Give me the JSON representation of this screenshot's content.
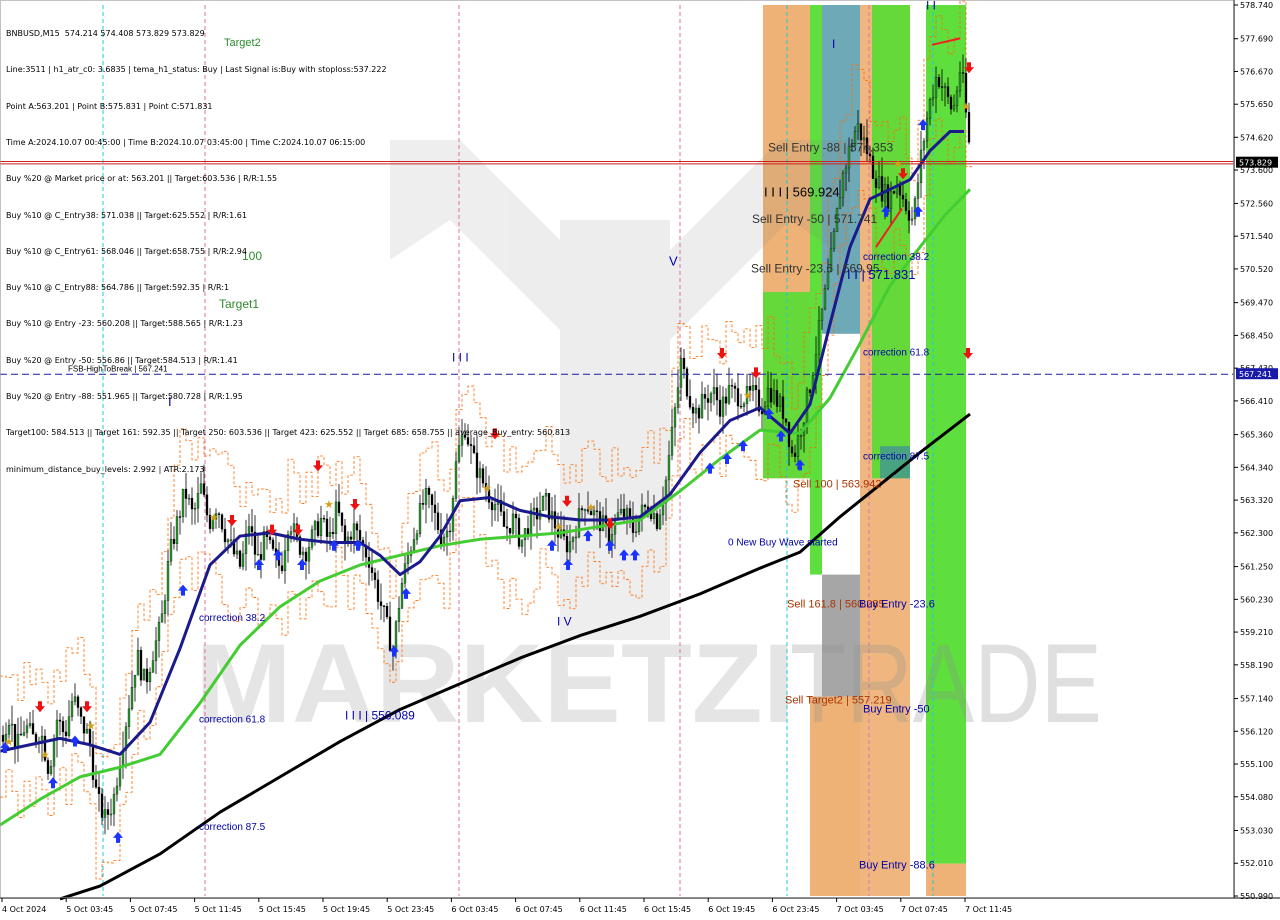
{
  "header_lines": [
    "BNBUSD,M15  574.214 574.408 573.829 573.829",
    "Line:3511 | h1_atr_c0: 3.6835 | tema_h1_status: Buy | Last Signal is:Buy with stoploss:537.222",
    "Point A:563.201 | Point B:575.831 | Point C:571.831",
    "Time A:2024.10.07 00:45:00 | Time B:2024.10.07 03:45:00 | Time C:2024.10.07 06:15:00",
    "Buy %20 @ Market price or at: 563.201 || Target:603.536 | R/R:1.55",
    "Buy %10 @ C_Entry38: 571.038 || Target:625.552 | R/R:1.61",
    "Buy %10 @ C_Entry61: 568.046 || Target:658.755 | R/R:2.94",
    "Buy %10 @ C_Entry88: 564.786 || Target:592.35 | R/R:1",
    "Buy %10 @ Entry -23: 560.208 || Target:588.565 | R/R:1.23",
    "Buy %20 @ Entry -50: 556.86 || Target:584.513 | R/R:1.41",
    "Buy %20 @ Entry -88: 551.965 || Target:580.728 | R/R:1.95",
    "Target100: 584.513 || Target 161: 592.35 || Target 250: 603.536 || Target 423: 625.552 || Target 685: 658.755 || average_Buy_entry: 560.813",
    "minimum_distance_buy_levels: 2.992 | ATR:2.173"
  ],
  "chart_data": {
    "type": "candlestick",
    "symbol": "BNBUSD",
    "timeframe": "M15",
    "ylim": [
      550.99,
      578.74
    ],
    "y_ticks": [
      578.74,
      577.69,
      576.67,
      575.65,
      574.62,
      573.6,
      572.56,
      571.54,
      570.52,
      569.47,
      568.45,
      567.43,
      566.41,
      565.36,
      564.34,
      563.32,
      562.3,
      561.25,
      560.23,
      559.21,
      558.19,
      557.14,
      556.12,
      555.1,
      554.08,
      553.03,
      552.01,
      550.99
    ],
    "y_tick_labels": [
      "578.740",
      "577.690",
      "576.670",
      "575.650",
      "574.620",
      "573.600",
      "572.560",
      "571.540",
      "570.520",
      "569.470",
      "568.450",
      "567.430",
      "566.410",
      "565.360",
      "564.340",
      "563.320",
      "562.300",
      "561.250",
      "560.230",
      "559.210",
      "558.190",
      "557.140",
      "556.120",
      "555.100",
      "554.080",
      "553.030",
      "552.010",
      "550.990"
    ],
    "x_labels": [
      "4 Oct 2024",
      "5 Oct 03:45",
      "5 Oct 07:45",
      "5 Oct 11:45",
      "5 Oct 15:45",
      "5 Oct 19:45",
      "5 Oct 23:45",
      "6 Oct 03:45",
      "6 Oct 07:45",
      "6 Oct 11:45",
      "6 Oct 15:45",
      "6 Oct 19:45",
      "6 Oct 23:45",
      "7 Oct 03:45",
      "7 Oct 07:45",
      "7 Oct 11:45"
    ],
    "current_price": 573.829,
    "current_price_label": "573.829",
    "fsb_level": 567.241,
    "fsb_level_label": "567.241",
    "close_path": [
      [
        0,
        556.0
      ],
      [
        8,
        556.6
      ],
      [
        16,
        555.6
      ],
      [
        24,
        556.3
      ],
      [
        32,
        555.9
      ],
      [
        40,
        556.1
      ],
      [
        48,
        554.9
      ],
      [
        56,
        556.5
      ],
      [
        64,
        556.0
      ],
      [
        72,
        557.2
      ],
      [
        80,
        556.4
      ],
      [
        88,
        555.9
      ],
      [
        96,
        554.0
      ],
      [
        104,
        553.4
      ],
      [
        112,
        553.9
      ],
      [
        120,
        555.5
      ],
      [
        128,
        557.0
      ],
      [
        136,
        558.5
      ],
      [
        144,
        557.6
      ],
      [
        152,
        558.6
      ],
      [
        160,
        559.4
      ],
      [
        168,
        561.5
      ],
      [
        176,
        562.6
      ],
      [
        184,
        563.6
      ],
      [
        192,
        562.8
      ],
      [
        200,
        563.7
      ],
      [
        208,
        562.6
      ],
      [
        216,
        563.2
      ],
      [
        224,
        562.3
      ],
      [
        232,
        561.7
      ],
      [
        240,
        561.2
      ],
      [
        248,
        562.6
      ],
      [
        256,
        561.4
      ],
      [
        264,
        562.1
      ],
      [
        272,
        561.6
      ],
      [
        280,
        561.2
      ],
      [
        288,
        562.8
      ],
      [
        296,
        562.0
      ],
      [
        304,
        561.7
      ],
      [
        312,
        562.2
      ],
      [
        320,
        562.7
      ],
      [
        328,
        562.0
      ],
      [
        336,
        563.1
      ],
      [
        344,
        561.9
      ],
      [
        352,
        562.5
      ],
      [
        360,
        562.0
      ],
      [
        368,
        561.5
      ],
      [
        376,
        560.5
      ],
      [
        384,
        559.6
      ],
      [
        392,
        558.6
      ],
      [
        400,
        560.6
      ],
      [
        408,
        561.7
      ],
      [
        416,
        562.6
      ],
      [
        424,
        563.4
      ],
      [
        432,
        563.0
      ],
      [
        440,
        562.2
      ],
      [
        448,
        562.4
      ],
      [
        456,
        564.7
      ],
      [
        464,
        565.6
      ],
      [
        472,
        564.6
      ],
      [
        480,
        564.0
      ],
      [
        488,
        563.5
      ],
      [
        496,
        563.1
      ],
      [
        504,
        562.4
      ],
      [
        512,
        562.7
      ],
      [
        520,
        562.0
      ],
      [
        528,
        562.6
      ],
      [
        536,
        562.9
      ],
      [
        544,
        563.3
      ],
      [
        552,
        562.7
      ],
      [
        560,
        562.1
      ],
      [
        568,
        561.9
      ],
      [
        576,
        562.6
      ],
      [
        584,
        563.3
      ],
      [
        592,
        562.9
      ],
      [
        600,
        562.6
      ],
      [
        608,
        562.2
      ],
      [
        616,
        562.8
      ],
      [
        624,
        562.9
      ],
      [
        632,
        562.4
      ],
      [
        640,
        562.9
      ],
      [
        648,
        563.2
      ],
      [
        656,
        562.7
      ],
      [
        664,
        563.7
      ],
      [
        672,
        565.6
      ],
      [
        680,
        567.6
      ],
      [
        688,
        566.6
      ],
      [
        696,
        566.0
      ],
      [
        704,
        566.5
      ],
      [
        712,
        566.7
      ],
      [
        720,
        566.2
      ],
      [
        728,
        566.7
      ],
      [
        736,
        566.6
      ],
      [
        744,
        566.5
      ],
      [
        752,
        566.6
      ],
      [
        760,
        566.2
      ],
      [
        768,
        566.8
      ],
      [
        776,
        566.4
      ],
      [
        784,
        566.0
      ],
      [
        792,
        564.6
      ],
      [
        800,
        565.6
      ],
      [
        808,
        566.7
      ],
      [
        816,
        568.2
      ],
      [
        824,
        569.7
      ],
      [
        832,
        571.2
      ],
      [
        840,
        573.2
      ],
      [
        848,
        574.2
      ],
      [
        856,
        575.0
      ],
      [
        864,
        574.4
      ],
      [
        872,
        573.6
      ],
      [
        880,
        573.0
      ],
      [
        888,
        572.7
      ],
      [
        896,
        573.2
      ],
      [
        904,
        572.6
      ],
      [
        912,
        572.0
      ],
      [
        920,
        574.0
      ],
      [
        928,
        575.6
      ],
      [
        936,
        576.6
      ],
      [
        944,
        576.0
      ],
      [
        952,
        575.4
      ],
      [
        960,
        576.9
      ],
      [
        968,
        574.4
      ]
    ],
    "ema_fast": [
      [
        0,
        555.5
      ],
      [
        30,
        555.7
      ],
      [
        60,
        555.9
      ],
      [
        90,
        555.7
      ],
      [
        120,
        555.4
      ],
      [
        150,
        556.4
      ],
      [
        180,
        558.7
      ],
      [
        210,
        561.3
      ],
      [
        240,
        562.2
      ],
      [
        270,
        562.3
      ],
      [
        300,
        562.1
      ],
      [
        330,
        562.0
      ],
      [
        360,
        562.0
      ],
      [
        380,
        561.6
      ],
      [
        400,
        561.0
      ],
      [
        420,
        561.4
      ],
      [
        440,
        562.2
      ],
      [
        460,
        563.3
      ],
      [
        490,
        563.4
      ],
      [
        520,
        563.0
      ],
      [
        550,
        562.8
      ],
      [
        580,
        562.7
      ],
      [
        610,
        562.7
      ],
      [
        640,
        562.8
      ],
      [
        670,
        563.5
      ],
      [
        700,
        564.8
      ],
      [
        730,
        565.8
      ],
      [
        760,
        566.2
      ],
      [
        790,
        565.4
      ],
      [
        810,
        566.3
      ],
      [
        830,
        568.8
      ],
      [
        850,
        571.2
      ],
      [
        870,
        572.7
      ],
      [
        890,
        573.0
      ],
      [
        910,
        573.3
      ],
      [
        930,
        574.2
      ],
      [
        950,
        574.8
      ],
      [
        964,
        574.8
      ]
    ],
    "ema_mid": [
      [
        0,
        553.2
      ],
      [
        40,
        554.0
      ],
      [
        80,
        554.7
      ],
      [
        120,
        555.0
      ],
      [
        160,
        555.4
      ],
      [
        200,
        557.0
      ],
      [
        240,
        558.8
      ],
      [
        280,
        560.0
      ],
      [
        320,
        560.8
      ],
      [
        360,
        561.3
      ],
      [
        400,
        561.6
      ],
      [
        440,
        561.9
      ],
      [
        480,
        562.1
      ],
      [
        520,
        562.2
      ],
      [
        560,
        562.3
      ],
      [
        600,
        562.5
      ],
      [
        640,
        562.7
      ],
      [
        680,
        563.6
      ],
      [
        720,
        564.6
      ],
      [
        760,
        565.5
      ],
      [
        800,
        565.4
      ],
      [
        830,
        566.5
      ],
      [
        860,
        568.2
      ],
      [
        890,
        570.0
      ],
      [
        920,
        571.2
      ],
      [
        945,
        572.2
      ],
      [
        970,
        573.0
      ]
    ],
    "ema_slow": [
      [
        60,
        550.9
      ],
      [
        100,
        551.3
      ],
      [
        160,
        552.3
      ],
      [
        220,
        553.6
      ],
      [
        280,
        554.7
      ],
      [
        340,
        555.8
      ],
      [
        400,
        556.8
      ],
      [
        460,
        557.6
      ],
      [
        520,
        558.4
      ],
      [
        580,
        559.1
      ],
      [
        640,
        559.7
      ],
      [
        700,
        560.4
      ],
      [
        760,
        561.2
      ],
      [
        800,
        561.7
      ],
      [
        840,
        562.8
      ],
      [
        880,
        563.8
      ],
      [
        920,
        564.8
      ],
      [
        970,
        566.0
      ]
    ],
    "zones": [
      {
        "x0": 763,
        "x1": 810,
        "y0": 564.0,
        "y1": 578.74,
        "color": "#e89848",
        "opacity": 0.75
      },
      {
        "x0": 763,
        "x1": 810,
        "y0": 564.0,
        "y1": 569.8,
        "color": "#55dd33",
        "opacity": 0.9
      },
      {
        "x0": 810,
        "x1": 822,
        "y0": 561.0,
        "y1": 578.74,
        "color": "#55dd33",
        "opacity": 0.95
      },
      {
        "x0": 822,
        "x1": 860,
        "y0": 568.5,
        "y1": 578.74,
        "color": "#3d8ca0",
        "opacity": 0.75
      },
      {
        "x0": 822,
        "x1": 860,
        "y0": 557.2,
        "y1": 561.0,
        "color": "#808080",
        "opacity": 0.7
      },
      {
        "x0": 810,
        "x1": 860,
        "y0": 550.99,
        "y1": 557.2,
        "color": "#e89848",
        "opacity": 0.75
      },
      {
        "x0": 860,
        "x1": 910,
        "y0": 550.99,
        "y1": 578.74,
        "color": "#e89848",
        "opacity": 0.7
      },
      {
        "x0": 872,
        "x1": 910,
        "y0": 564.0,
        "y1": 578.74,
        "color": "#55dd33",
        "opacity": 0.9
      },
      {
        "x0": 880,
        "x1": 910,
        "y0": 564.0,
        "y1": 565.0,
        "color": "#3d8ca0",
        "opacity": 0.7
      },
      {
        "x0": 926,
        "x1": 966,
        "y0": 552.0,
        "y1": 578.74,
        "color": "#55dd33",
        "opacity": 0.95
      },
      {
        "x0": 926,
        "x1": 966,
        "y0": 550.99,
        "y1": 552.0,
        "color": "#e89848",
        "opacity": 0.75
      }
    ],
    "v_lines_pink": [
      205,
      459,
      680,
      869
    ],
    "v_lines_cyan": [
      103,
      787,
      933
    ],
    "annotations": [
      {
        "text": "100",
        "x": 242,
        "price": 570.8,
        "color": "#2e8b2e",
        "size": 12
      },
      {
        "text": "Target1",
        "x": 219,
        "price": 569.3,
        "color": "#2e8b2e",
        "size": 12
      },
      {
        "text": "Target2",
        "x": 224,
        "price": 577.47,
        "color": "#2e8b2e",
        "size": 11
      },
      {
        "text": "FSB-HighToBreak | 567.241",
        "x": 68,
        "price": 567.33,
        "color": "#000000",
        "size": 8
      },
      {
        "text": "I",
        "x": 168,
        "price": 566.25,
        "color": "#0000aa",
        "size": 13
      },
      {
        "text": "I I I",
        "x": 452,
        "price": 567.63,
        "color": "#0000aa",
        "size": 12
      },
      {
        "text": "V",
        "x": 669,
        "price": 570.63,
        "color": "#0000aa",
        "size": 13
      },
      {
        "text": "I V",
        "x": 557,
        "price": 559.41,
        "color": "#0000aa",
        "size": 12
      },
      {
        "text": "I",
        "x": 832,
        "price": 577.4,
        "color": "#0000aa",
        "size": 12
      },
      {
        "text": "I I",
        "x": 926,
        "price": 578.6,
        "color": "#0000aa",
        "size": 12
      },
      {
        "text": "correction 38.2",
        "x": 199,
        "price": 559.56,
        "color": "#0000aa",
        "size": 10
      },
      {
        "text": "correction 61.8",
        "x": 199,
        "price": 556.39,
        "color": "#0000aa",
        "size": 10
      },
      {
        "text": "correction 87.5",
        "x": 199,
        "price": 553.05,
        "color": "#0000aa",
        "size": 10
      },
      {
        "text": "I I I | 556.089",
        "x": 345,
        "price": 556.48,
        "color": "#0000aa",
        "size": 12
      },
      {
        "text": "Sell Entry -88 | 574.353",
        "x": 768,
        "price": 574.17,
        "color": "#333333",
        "size": 12
      },
      {
        "text": "I I I | 569.924",
        "x": 764,
        "price": 572.77,
        "color": "#000000",
        "size": 13
      },
      {
        "text": "Sell Entry -50 | 571.741",
        "x": 752,
        "price": 571.95,
        "color": "#333333",
        "size": 12
      },
      {
        "text": "Sell Entry -23.6 | 569.95",
        "x": 751,
        "price": 570.41,
        "color": "#333333",
        "size": 12
      },
      {
        "text": "I I | 571.831",
        "x": 847,
        "price": 570.2,
        "color": "#0000aa",
        "size": 13
      },
      {
        "text": "correction 38.2",
        "x": 863,
        "price": 570.8,
        "color": "#0000aa",
        "size": 10
      },
      {
        "text": "correction 61.8",
        "x": 863,
        "price": 567.83,
        "color": "#0000aa",
        "size": 10
      },
      {
        "text": "correction 87.5",
        "x": 863,
        "price": 564.58,
        "color": "#0000aa",
        "size": 10
      },
      {
        "text": "Sell 100 | 563.942",
        "x": 793,
        "price": 563.72,
        "color": "#aa3300",
        "size": 11
      },
      {
        "text": "0 New Buy Wave started",
        "x": 728,
        "price": 561.9,
        "color": "#0000aa",
        "size": 10
      },
      {
        "text": "Sell 161.8 | 560.285",
        "x": 787,
        "price": 559.98,
        "color": "#aa3300",
        "size": 11
      },
      {
        "text": "Buy Entry -23.6",
        "x": 859,
        "price": 559.98,
        "color": "#0000aa",
        "size": 11
      },
      {
        "text": "Sell Target2 | 557.219",
        "x": 785,
        "price": 556.99,
        "color": "#aa3300",
        "size": 11
      },
      {
        "text": "Buy Entry -50",
        "x": 863,
        "price": 556.71,
        "color": "#0000aa",
        "size": 11
      },
      {
        "text": "Buy Entry -88.6",
        "x": 859,
        "price": 551.84,
        "color": "#0000aa",
        "size": 11
      }
    ],
    "buy_arrows": [
      [
        5,
        555.6
      ],
      [
        53,
        554.5
      ],
      [
        75,
        555.8
      ],
      [
        118,
        552.8
      ],
      [
        183,
        560.5
      ],
      [
        259,
        561.3
      ],
      [
        278,
        561.6
      ],
      [
        302,
        561.3
      ],
      [
        334,
        561.9
      ],
      [
        358,
        561.9
      ],
      [
        394,
        558.6
      ],
      [
        406,
        560.4
      ],
      [
        552,
        561.9
      ],
      [
        568,
        561.3
      ],
      [
        588,
        562.2
      ],
      [
        610,
        561.9
      ],
      [
        624,
        561.6
      ],
      [
        635,
        561.6
      ],
      [
        710,
        564.3
      ],
      [
        727,
        564.6
      ],
      [
        743,
        565.0
      ],
      [
        769,
        566.0
      ],
      [
        781,
        565.3
      ],
      [
        800,
        564.4
      ],
      [
        886,
        572.3
      ],
      [
        918,
        572.3
      ],
      [
        923,
        575.0
      ]
    ],
    "sell_arrows": [
      [
        40,
        556.9
      ],
      [
        87,
        556.9
      ],
      [
        232,
        562.7
      ],
      [
        272,
        562.4
      ],
      [
        298,
        562.4
      ],
      [
        318,
        564.4
      ],
      [
        355,
        563.2
      ],
      [
        495,
        565.4
      ],
      [
        567,
        563.3
      ],
      [
        610,
        562.6
      ],
      [
        722,
        567.9
      ],
      [
        756,
        567.3
      ],
      [
        903,
        573.5
      ],
      [
        969,
        576.8
      ],
      [
        968,
        567.9
      ]
    ],
    "stars": [
      [
        8,
        555.8
      ],
      [
        44,
        555.4
      ],
      [
        90,
        556.3
      ],
      [
        213,
        562.8
      ],
      [
        328,
        563.2
      ],
      [
        486,
        563.7
      ],
      [
        558,
        562.5
      ],
      [
        590,
        563.1
      ],
      [
        747,
        566.6
      ],
      [
        897,
        573.8
      ],
      [
        965,
        575.6
      ]
    ]
  },
  "watermark": {
    "left": "MARKETZI",
    "right": "TRADE"
  }
}
